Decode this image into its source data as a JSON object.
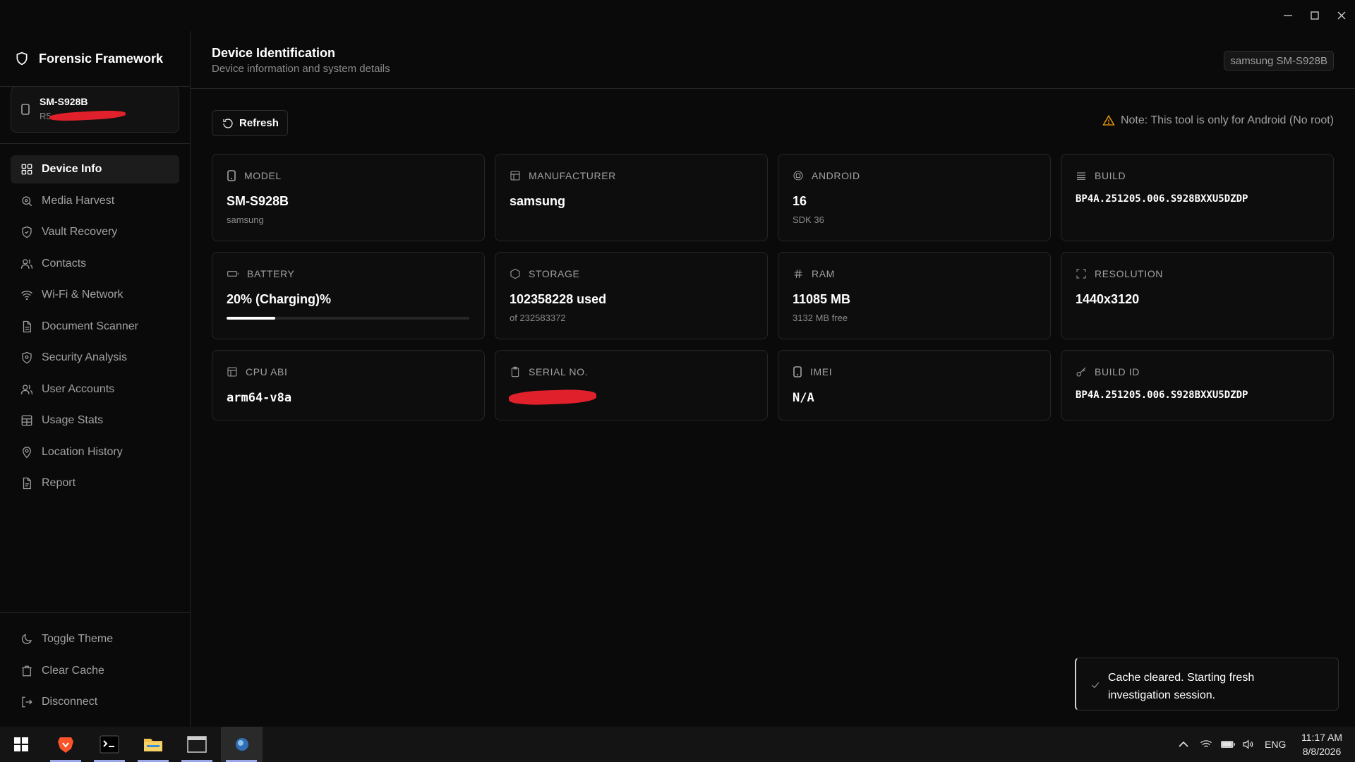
{
  "app": {
    "name": "Forensic Framework"
  },
  "device_card": {
    "model": "SM-S928B",
    "serial_prefix": "R5"
  },
  "nav": {
    "items": [
      {
        "label": "Device Info",
        "icon": "grid-icon"
      },
      {
        "label": "Media Harvest",
        "icon": "search-image-icon"
      },
      {
        "label": "Vault Recovery",
        "icon": "shield-check-icon"
      },
      {
        "label": "Contacts",
        "icon": "users-icon"
      },
      {
        "label": "Wi-Fi & Network",
        "icon": "wifi-icon"
      },
      {
        "label": "Document Scanner",
        "icon": "file-text-icon"
      },
      {
        "label": "Security Analysis",
        "icon": "shield-alert-icon"
      },
      {
        "label": "User Accounts",
        "icon": "user-accounts-icon"
      },
      {
        "label": "Usage Stats",
        "icon": "table-icon"
      },
      {
        "label": "Location History",
        "icon": "map-pin-icon"
      },
      {
        "label": "Report",
        "icon": "report-icon"
      }
    ],
    "bottom": [
      {
        "label": "Toggle Theme",
        "icon": "moon-icon"
      },
      {
        "label": "Clear Cache",
        "icon": "trash-icon"
      },
      {
        "label": "Disconnect",
        "icon": "logout-icon"
      }
    ]
  },
  "header": {
    "title": "Device Identification",
    "subtitle": "Device information and system details",
    "device_badge": "samsung SM-S928B"
  },
  "toolbar": {
    "refresh_label": "Refresh",
    "note": "Note: This tool is only for Android (No root)"
  },
  "cards": {
    "model": {
      "label": "MODEL",
      "value": "SM-S928B",
      "sub": "samsung"
    },
    "manufacturer": {
      "label": "MANUFACTURER",
      "value": "samsung"
    },
    "android": {
      "label": "ANDROID",
      "value": "16",
      "sub": "SDK 36"
    },
    "build": {
      "label": "BUILD",
      "value": "BP4A.251205.006.S928BXXU5DZDP"
    },
    "battery": {
      "label": "BATTERY",
      "value": "20% (Charging)%",
      "level": 0.2
    },
    "storage": {
      "label": "STORAGE",
      "value": "102358228 used",
      "sub": "of 232583372"
    },
    "ram": {
      "label": "RAM",
      "value": "11085 MB",
      "sub": "3132 MB free"
    },
    "resolution": {
      "label": "RESOLUTION",
      "value": "1440x3120"
    },
    "cpu_abi": {
      "label": "CPU ABI",
      "value": "arm64-v8a"
    },
    "serial": {
      "label": "SERIAL NO."
    },
    "imei": {
      "label": "IMEI",
      "value": "N/A"
    },
    "build_id": {
      "label": "BUILD ID",
      "value": "BP4A.251205.006.S928BXXU5DZDP"
    }
  },
  "toast": {
    "message": "Cache cleared. Starting fresh investigation session."
  },
  "taskbar": {
    "language": "ENG",
    "time": "11:17 AM",
    "date": "8/8/2026"
  },
  "colors": {
    "accent_warning": "#f59e0b",
    "redaction": "#e0202a",
    "taskbar_indicator": "#9aa6e8"
  }
}
